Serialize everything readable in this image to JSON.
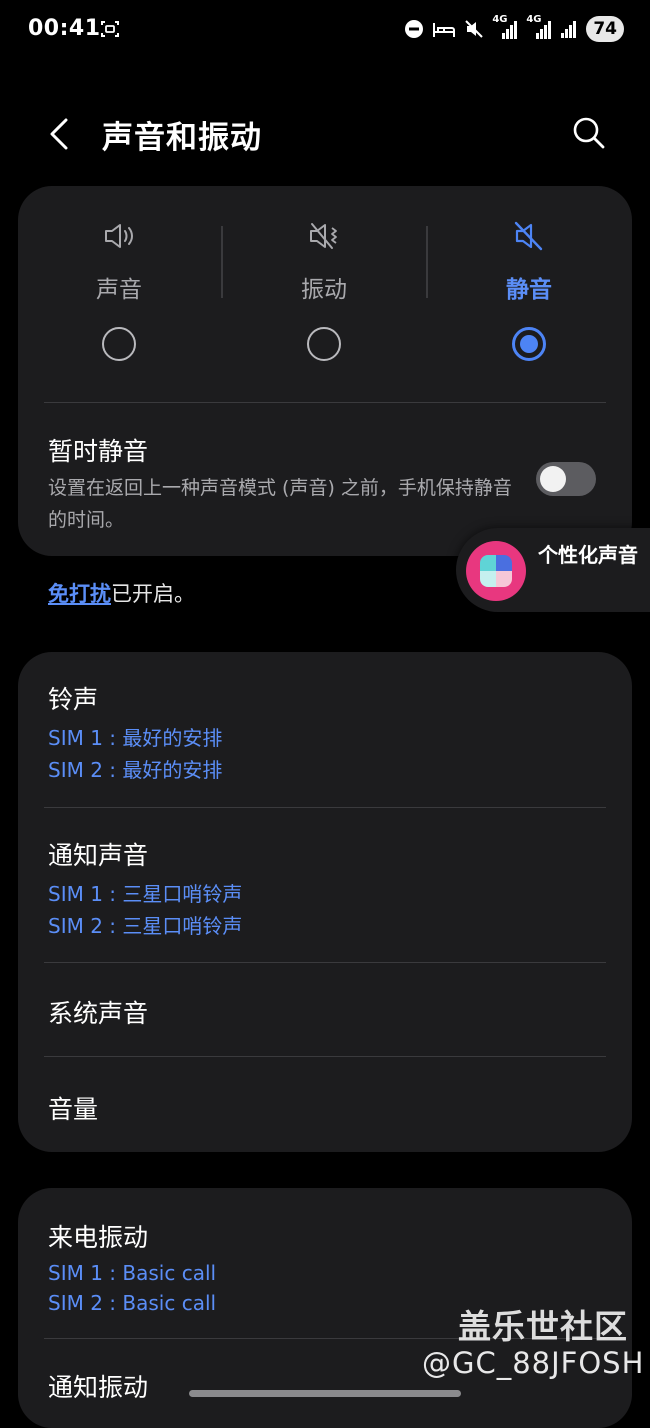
{
  "status_bar": {
    "time": "00:41",
    "battery": "74",
    "network_labels": [
      "4G",
      "4G"
    ]
  },
  "header": {
    "title": "声音和振动"
  },
  "sound_modes": {
    "items": [
      {
        "label": "声音",
        "icon": "speaker-icon",
        "selected": false
      },
      {
        "label": "振动",
        "icon": "vibrate-icon",
        "selected": false
      },
      {
        "label": "静音",
        "icon": "mute-icon",
        "selected": true
      }
    ],
    "accent_color": "#4d84f5"
  },
  "temporary_mute": {
    "title": "暂时静音",
    "description": "设置在返回上一种声音模式 (声音) 之前，手机保持静音的时间。",
    "enabled": false
  },
  "dnd_notice": {
    "link": "免打扰",
    "text": "已开启。"
  },
  "floating_shortcut": {
    "label": "个性化声音"
  },
  "sound_settings": [
    {
      "title": "铃声",
      "sub": [
        "SIM 1 : 最好的安排",
        "SIM 2 : 最好的安排"
      ]
    },
    {
      "title": "通知声音",
      "sub": [
        "SIM 1 : 三星口哨铃声",
        "SIM 2 : 三星口哨铃声"
      ]
    },
    {
      "title": "系统声音",
      "sub": []
    },
    {
      "title": "音量",
      "sub": []
    }
  ],
  "vibration_settings": [
    {
      "title": "来电振动",
      "sub": [
        "SIM 1 : Basic call",
        "SIM 2 : Basic call"
      ]
    },
    {
      "title": "通知振动",
      "sub": []
    }
  ],
  "watermark": {
    "line1": "盖乐世社区",
    "line2": "@GC_88JFOSH"
  }
}
